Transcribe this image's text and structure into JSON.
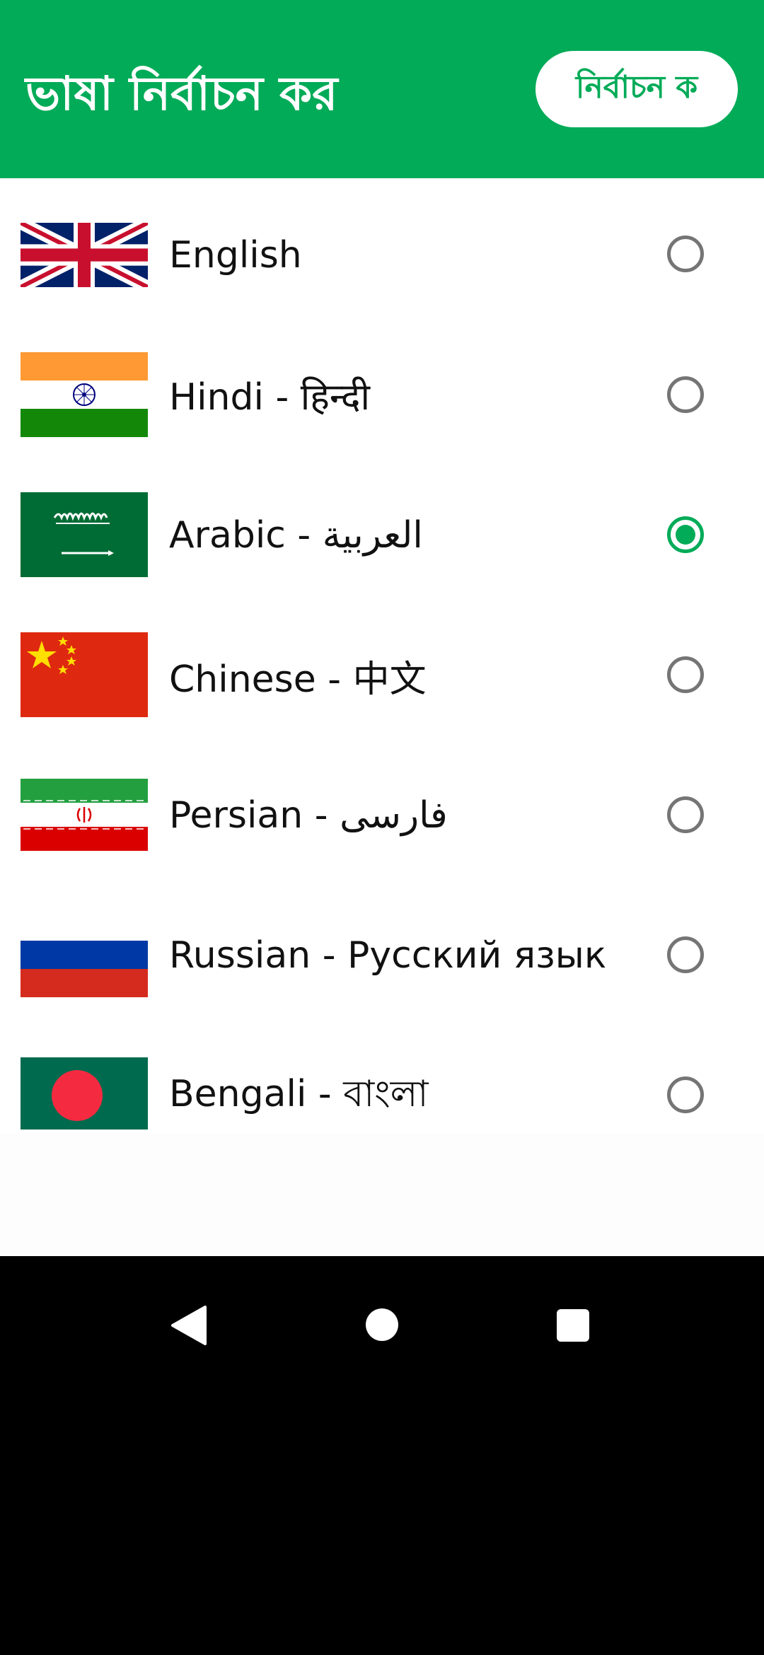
{
  "header": {
    "title": "ভাষা নির্বাচন কর",
    "select_button": "নির্বাচন ক"
  },
  "languages": [
    {
      "label": "English",
      "flag": "uk-flag-icon",
      "selected": false
    },
    {
      "label": "Hindi - हिन्दी",
      "flag": "india-flag-icon",
      "selected": false
    },
    {
      "label": "Arabic - العربية",
      "flag": "saudi-arabia-flag-icon",
      "selected": true
    },
    {
      "label": "Chinese - 中文",
      "flag": "china-flag-icon",
      "selected": false
    },
    {
      "label": "Persian - فارسی",
      "flag": "iran-flag-icon",
      "selected": false
    },
    {
      "label": "Russian - Русский язык",
      "flag": "russia-flag-icon",
      "selected": false
    },
    {
      "label": "Bengali - বাংলা",
      "flag": "bangladesh-flag-icon",
      "selected": false
    }
  ],
  "colors": {
    "accent": "#02ab58",
    "radio_unchecked": "#757575"
  },
  "navigation": {
    "back": "back-icon",
    "home": "home-icon",
    "recents": "recents-icon"
  }
}
